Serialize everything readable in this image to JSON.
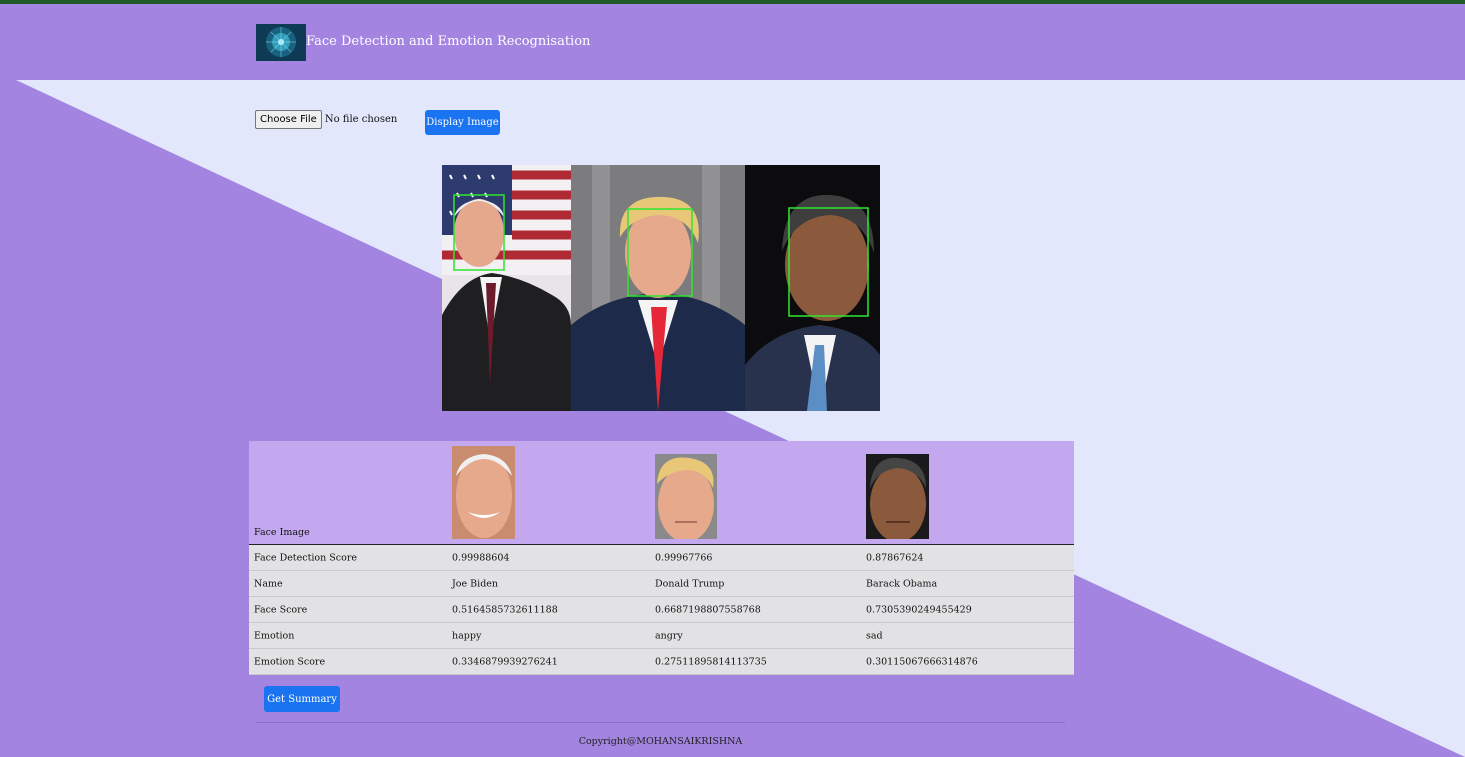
{
  "header": {
    "title": "Face Detection and Emotion Recognisation",
    "logo_icon": "neural-brain-logo"
  },
  "upload": {
    "choose_label": "Choose File",
    "status": "No file chosen",
    "display_button": "Display Image"
  },
  "results": {
    "row_labels": [
      "Face Image",
      "Face Detection Score",
      "Name",
      "Face Score",
      "Emotion",
      "Emotion Score"
    ],
    "faces": [
      {
        "detection_score": "0.99988604",
        "name": "Joe Biden",
        "face_score": "0.5164585732611188",
        "emotion": "happy",
        "emotion_score": "0.3346879939276241"
      },
      {
        "detection_score": "0.99967766",
        "name": "Donald Trump",
        "face_score": "0.6687198807558768",
        "emotion": "angry",
        "emotion_score": "0.27511895814113735"
      },
      {
        "detection_score": "0.87867624",
        "name": "Barack Obama",
        "face_score": "0.7305390249455429",
        "emotion": "sad",
        "emotion_score": "0.30115067666314876"
      }
    ]
  },
  "summary_button": "Get Summary",
  "footer": {
    "copyright": "Copyright@MOHANSAIKRISHNA"
  },
  "colors": {
    "header": "#a484e1",
    "background_light": "#e3e7fb",
    "primary_button": "#1a73f0",
    "face_box": "#2ee62e",
    "table_header": "#c3a8f0",
    "table_row": "#e2e2e4"
  }
}
